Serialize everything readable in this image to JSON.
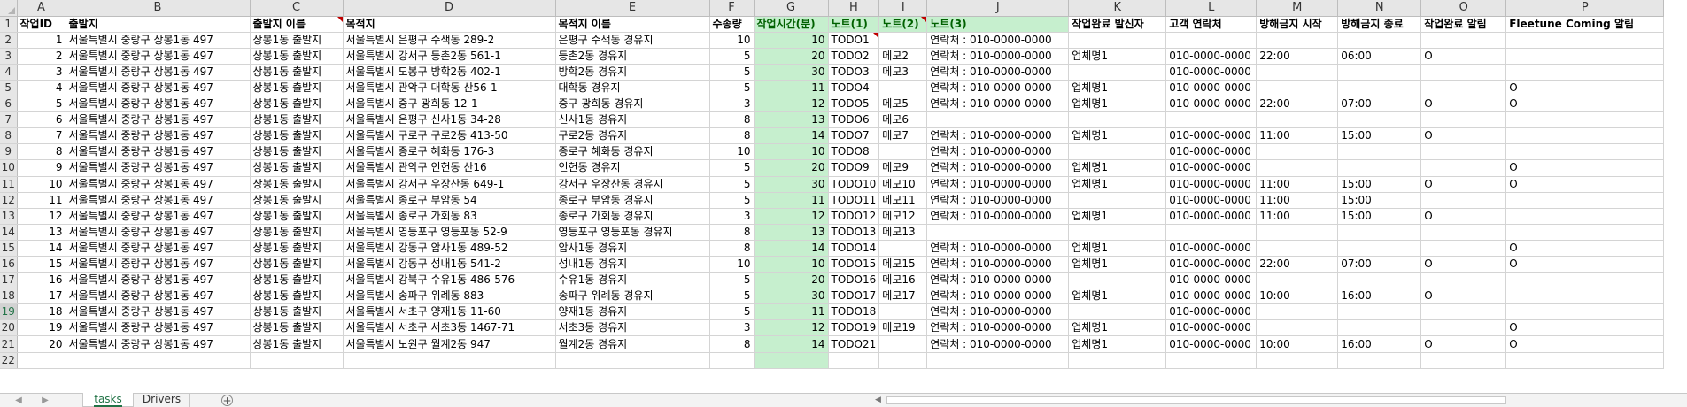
{
  "columns": [
    "A",
    "B",
    "C",
    "D",
    "E",
    "F",
    "G",
    "H",
    "I",
    "J",
    "K",
    "L",
    "M",
    "N",
    "O",
    "P"
  ],
  "headers": [
    "작업ID",
    "출발지",
    "출발지 이름",
    "목적지",
    "목적지 이름",
    "수송량",
    "작업시간(분)",
    "노트(1)",
    "노트(2)",
    "노트(3)",
    "작업완료 발신자",
    "고객 연락처",
    "방해금지 시작",
    "방해금지 종료",
    "작업완료 알림",
    "Fleetune Coming 알림"
  ],
  "rows": [
    [
      "1",
      "서울특별시 중랑구 상봉1동 497",
      "상봉1동 출발지",
      "서울특별시 은평구 수색동 289-2",
      "은평구 수색동 경유지",
      "10",
      "10",
      "TODO1",
      "",
      "연락처 : 010-0000-0000",
      "",
      "",
      "",
      "",
      "",
      ""
    ],
    [
      "2",
      "서울특별시 중랑구 상봉1동 497",
      "상봉1동 출발지",
      "서울특별시 강서구 등촌2동 561-1",
      "등촌2동 경유지",
      "5",
      "20",
      "TODO2",
      "메모2",
      "연락처 : 010-0000-0000",
      "업체명1",
      "010-0000-0000",
      "22:00",
      "06:00",
      "O",
      ""
    ],
    [
      "3",
      "서울특별시 중랑구 상봉1동 497",
      "상봉1동 출발지",
      "서울특별시 도봉구 방학2동 402-1",
      "방학2동 경유지",
      "5",
      "30",
      "TODO3",
      "메모3",
      "연락처 : 010-0000-0000",
      "",
      "010-0000-0000",
      "",
      "",
      "",
      ""
    ],
    [
      "4",
      "서울특별시 중랑구 상봉1동 497",
      "상봉1동 출발지",
      "서울특별시 관악구 대학동 산56-1",
      "대학동 경유지",
      "5",
      "11",
      "TODO4",
      "",
      "연락처 : 010-0000-0000",
      "업체명1",
      "010-0000-0000",
      "",
      "",
      "",
      "O"
    ],
    [
      "5",
      "서울특별시 중랑구 상봉1동 497",
      "상봉1동 출발지",
      "서울특별시 중구 광희동 12-1",
      "중구 광희동 경유지",
      "3",
      "12",
      "TODO5",
      "메모5",
      "연락처 : 010-0000-0000",
      "업체명1",
      "010-0000-0000",
      "22:00",
      "07:00",
      "O",
      "O"
    ],
    [
      "6",
      "서울특별시 중랑구 상봉1동 497",
      "상봉1동 출발지",
      "서울특별시 은평구 신사1동 34-28",
      "신사1동 경유지",
      "8",
      "13",
      "TODO6",
      "메모6",
      "",
      "",
      "",
      "",
      "",
      "",
      ""
    ],
    [
      "7",
      "서울특별시 중랑구 상봉1동 497",
      "상봉1동 출발지",
      "서울특별시 구로구 구로2동 413-50",
      "구로2동 경유지",
      "8",
      "14",
      "TODO7",
      "메모7",
      "연락처 : 010-0000-0000",
      "업체명1",
      "010-0000-0000",
      "11:00",
      "15:00",
      "O",
      ""
    ],
    [
      "8",
      "서울특별시 중랑구 상봉1동 497",
      "상봉1동 출발지",
      "서울특별시 종로구 혜화동 176-3",
      "종로구 혜화동 경유지",
      "10",
      "10",
      "TODO8",
      "",
      "연락처 : 010-0000-0000",
      "",
      "010-0000-0000",
      "",
      "",
      "",
      ""
    ],
    [
      "9",
      "서울특별시 중랑구 상봉1동 497",
      "상봉1동 출발지",
      "서울특별시 관악구 인헌동 산16",
      "인헌동 경유지",
      "5",
      "20",
      "TODO9",
      "메모9",
      "연락처 : 010-0000-0000",
      "업체명1",
      "010-0000-0000",
      "",
      "",
      "",
      "O"
    ],
    [
      "10",
      "서울특별시 중랑구 상봉1동 497",
      "상봉1동 출발지",
      "서울특별시 강서구 우장산동 649-1",
      "강서구 우장산동 경유지",
      "5",
      "30",
      "TODO10",
      "메모10",
      "연락처 : 010-0000-0000",
      "업체명1",
      "010-0000-0000",
      "11:00",
      "15:00",
      "O",
      "O"
    ],
    [
      "11",
      "서울특별시 중랑구 상봉1동 497",
      "상봉1동 출발지",
      "서울특별시 종로구 부암동 54",
      "종로구 부암동 경유지",
      "5",
      "11",
      "TODO11",
      "메모11",
      "연락처 : 010-0000-0000",
      "",
      "010-0000-0000",
      "11:00",
      "15:00",
      "",
      ""
    ],
    [
      "12",
      "서울특별시 중랑구 상봉1동 497",
      "상봉1동 출발지",
      "서울특별시 종로구 가회동 83",
      "종로구 가회동 경유지",
      "3",
      "12",
      "TODO12",
      "메모12",
      "연락처 : 010-0000-0000",
      "업체명1",
      "010-0000-0000",
      "11:00",
      "15:00",
      "O",
      ""
    ],
    [
      "13",
      "서울특별시 중랑구 상봉1동 497",
      "상봉1동 출발지",
      "서울특별시 영등포구 영등포동 52-9",
      "영등포구 영등포동 경유지",
      "8",
      "13",
      "TODO13",
      "메모13",
      "",
      "",
      "",
      "",
      "",
      "",
      ""
    ],
    [
      "14",
      "서울특별시 중랑구 상봉1동 497",
      "상봉1동 출발지",
      "서울특별시 강동구 암사1동 489-52",
      "암사1동 경유지",
      "8",
      "14",
      "TODO14",
      "",
      "연락처 : 010-0000-0000",
      "업체명1",
      "010-0000-0000",
      "",
      "",
      "",
      "O"
    ],
    [
      "15",
      "서울특별시 중랑구 상봉1동 497",
      "상봉1동 출발지",
      "서울특별시 강동구 성내1동 541-2",
      "성내1동 경유지",
      "10",
      "10",
      "TODO15",
      "메모15",
      "연락처 : 010-0000-0000",
      "업체명1",
      "010-0000-0000",
      "22:00",
      "07:00",
      "O",
      "O"
    ],
    [
      "16",
      "서울특별시 중랑구 상봉1동 497",
      "상봉1동 출발지",
      "서울특별시 강북구 수유1동 486-576",
      "수유1동 경유지",
      "5",
      "20",
      "TODO16",
      "메모16",
      "연락처 : 010-0000-0000",
      "",
      "010-0000-0000",
      "",
      "",
      "",
      ""
    ],
    [
      "17",
      "서울특별시 중랑구 상봉1동 497",
      "상봉1동 출발지",
      "서울특별시 송파구 위례동 883",
      "송파구 위례동 경유지",
      "5",
      "30",
      "TODO17",
      "메모17",
      "연락처 : 010-0000-0000",
      "업체명1",
      "010-0000-0000",
      "10:00",
      "16:00",
      "O",
      ""
    ],
    [
      "18",
      "서울특별시 중랑구 상봉1동 497",
      "상봉1동 출발지",
      "서울특별시 서초구 양재1동 11-60",
      "양재1동 경유지",
      "5",
      "11",
      "TODO18",
      "",
      "연락처 : 010-0000-0000",
      "",
      "010-0000-0000",
      "",
      "",
      "",
      ""
    ],
    [
      "19",
      "서울특별시 중랑구 상봉1동 497",
      "상봉1동 출발지",
      "서울특별시 서초구 서초3동 1467-71",
      "서초3동 경유지",
      "3",
      "12",
      "TODO19",
      "메모19",
      "연락처 : 010-0000-0000",
      "업체명1",
      "010-0000-0000",
      "",
      "",
      "",
      "O"
    ],
    [
      "20",
      "서울특별시 중랑구 상봉1동 497",
      "상봉1동 출발지",
      "서울특별시 노원구 월계2동 947",
      "월계2동 경유지",
      "8",
      "14",
      "TODO21",
      "",
      "연락처 : 010-0000-0000",
      "업체명1",
      "010-0000-0000",
      "10:00",
      "16:00",
      "O",
      "O"
    ]
  ],
  "sheet_tabs": [
    "tasks",
    "Drivers"
  ],
  "active_tab": "tasks",
  "colors": {
    "highlight_fill": "#c6efce",
    "highlight_text": "#006100",
    "accent": "#217346",
    "comment_marker": "#c00000"
  },
  "icons": {
    "nav_left": "◀",
    "nav_right": "▶",
    "add_sheet": "+",
    "scroll_left": "◀"
  }
}
